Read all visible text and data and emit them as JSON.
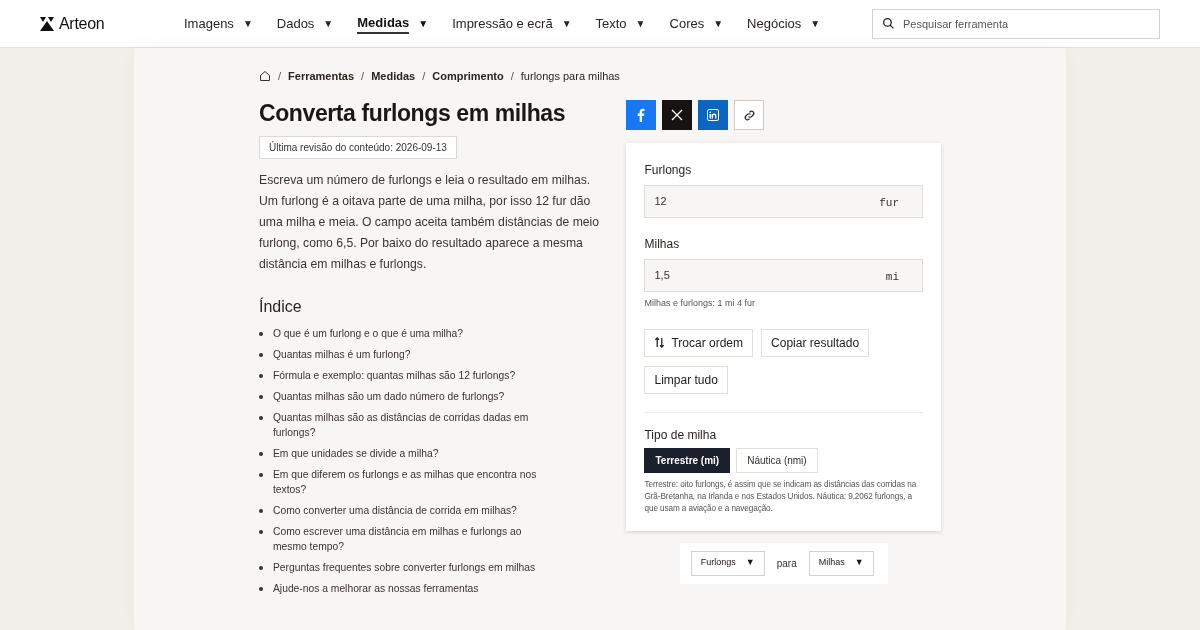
{
  "header": {
    "logo": "Arteon",
    "nav": [
      {
        "label": "Imagens",
        "caret": "▼",
        "selected": false
      },
      {
        "label": "Dados",
        "caret": "▼",
        "selected": false
      },
      {
        "label": "Medidas",
        "caret": "▼",
        "selected": true
      },
      {
        "label": "Impressão e ecrã",
        "caret": "▼",
        "selected": false
      },
      {
        "label": "Texto",
        "caret": "▼",
        "selected": false
      },
      {
        "label": "Cores",
        "caret": "▼",
        "selected": false
      },
      {
        "label": "Negócios",
        "caret": "▼",
        "selected": false
      }
    ],
    "search": {
      "placeholder": "Pesquisar ferramenta"
    }
  },
  "breadcrumb": {
    "separator": "/",
    "items": [
      "Ferramentas",
      "Medidas",
      "Comprimento",
      "furlongs para milhas"
    ]
  },
  "title": "Converta furlongs em milhas",
  "revision": "Última revisão do conteúdo: 2026-09-13",
  "intro": "Escreva um número de furlongs e leia o resultado em milhas. Um furlong é a oitava parte de uma milha, por isso 12 fur dão uma milha e meia. O campo aceita também distâncias de meio furlong, como 6,5. Por baixo do resultado aparece a mesma distância em milhas e furlongs.",
  "toc": {
    "heading": "Índice",
    "items": [
      "O que é um furlong e o que é uma milha?",
      "Quantas milhas é um furlong?",
      "Fórmula e exemplo: quantas milhas são 12 furlongs?",
      "Quantas milhas são um dado número de furlongs?",
      "Quantas milhas são as distâncias de corridas dadas em furlongs?",
      "Em que unidades se divide a milha?",
      "Em que diferem os furlongs e as milhas que encontra nos textos?",
      "Como converter uma distância de corrida em milhas?",
      "Como escrever uma distância em milhas e furlongs ao mesmo tempo?",
      "Perguntas frequentes sobre converter furlongs em milhas",
      "Ajude-nos a melhorar as nossas ferramentas"
    ]
  },
  "share": [
    {
      "kind": "facebook"
    },
    {
      "kind": "x"
    },
    {
      "kind": "linkedin"
    },
    {
      "kind": "link"
    }
  ],
  "converter": {
    "fields": [
      {
        "label": "Furlongs",
        "value": "12",
        "unit": "fur"
      },
      {
        "label": "Milhas",
        "value": "1,5",
        "unit": "mi",
        "hint": "Milhas e furlongs: 1 mi 4 fur"
      }
    ],
    "buttons": [
      {
        "label": "Trocar ordem",
        "kind": "swap"
      },
      {
        "label": "Copiar resultado",
        "kind": "plain"
      },
      {
        "label": "Limpar tudo",
        "kind": "plain"
      }
    ],
    "mile_type": {
      "heading": "Tipo de milha",
      "options": [
        {
          "label": "Terrestre (mi)",
          "selected": true
        },
        {
          "label": "Náutica (nmi)",
          "selected": false
        }
      ],
      "note": "Terrestre: oito furlongs, é assim que se indicam as distâncias das corridas na Grã-Bretanha, na Irlanda e nos Estados Unidos. Náutica: 9,2062 furlongs, a que usam a aviação e a navegação."
    }
  },
  "unit_picker": {
    "from": "Furlongs",
    "from_caret": "▼",
    "joiner": "para",
    "to": "Milhas",
    "to_caret": "▼"
  }
}
